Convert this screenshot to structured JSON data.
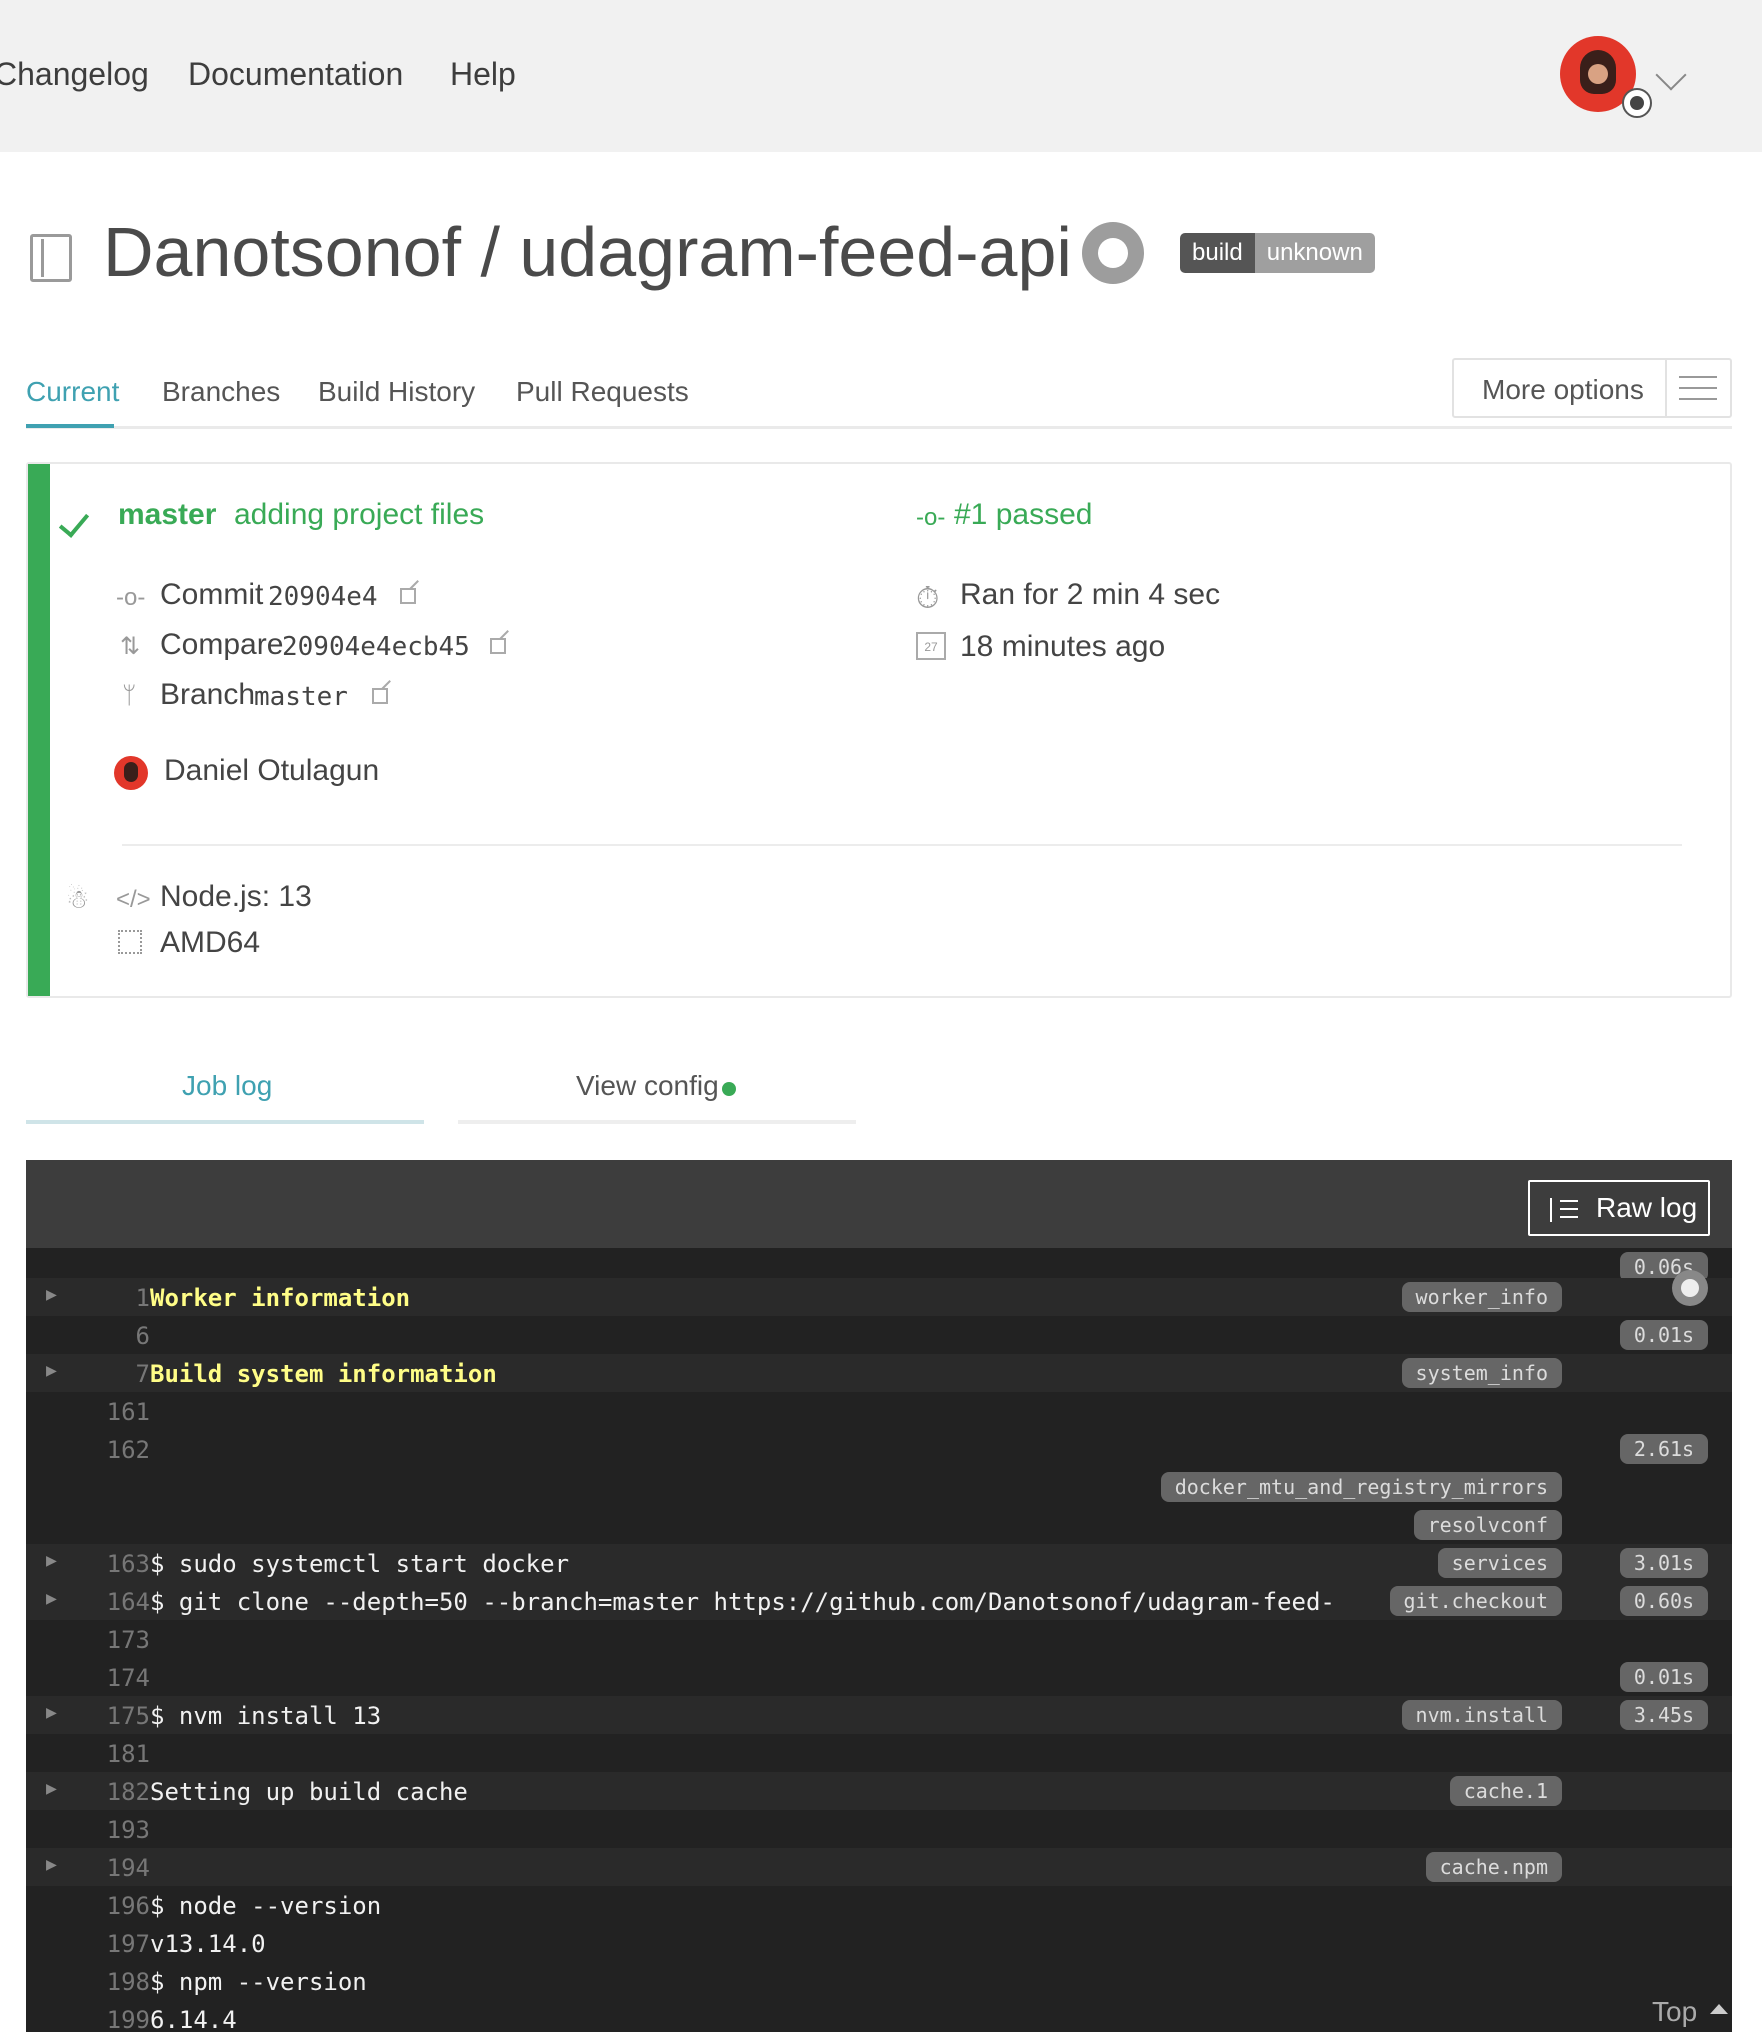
{
  "nav": {
    "links": [
      "Changelog",
      "Documentation",
      "Help"
    ]
  },
  "repo": {
    "title": "Danotsonof / udagram-feed-api",
    "badge_left": "build",
    "badge_right": "unknown"
  },
  "tabs": {
    "items": [
      "Current",
      "Branches",
      "Build History",
      "Pull Requests"
    ],
    "active": "Current",
    "more_options": "More options"
  },
  "build": {
    "branch": "master",
    "message": "adding project files",
    "status": "#1 passed",
    "commit_label": "Commit",
    "commit_value": "20904e4",
    "compare_label": "Compare",
    "compare_value": "20904e4ecb45",
    "branch_label": "Branch",
    "branch_value": "master",
    "ran_for": "Ran for 2 min 4 sec",
    "ago": "18 minutes ago",
    "calendar_day": "27",
    "author": "Daniel Otulagun",
    "language": "Node.js: 13",
    "arch": "AMD64",
    "status_color": "#39aa56"
  },
  "lower_tabs": {
    "job_log": "Job log",
    "view_config": "View config"
  },
  "log": {
    "raw_log": "Raw log",
    "top": "Top",
    "lines": [
      {
        "num": "1",
        "text": "Worker information",
        "tag": "worker_info",
        "time": "",
        "fold": true,
        "yellow": true
      },
      {
        "num": "6",
        "text": "",
        "tag": "",
        "time": "0.01s",
        "fold": false,
        "yellow": false
      },
      {
        "num": "7",
        "text": "Build system information",
        "tag": "system_info",
        "time": "",
        "fold": true,
        "yellow": true
      },
      {
        "num": "161",
        "text": "",
        "tag": "",
        "time": "",
        "fold": false,
        "yellow": false
      },
      {
        "num": "162",
        "text": "",
        "tag": "",
        "time": "2.61s",
        "fold": false,
        "yellow": false
      },
      {
        "num": "",
        "text": "",
        "tag": "docker_mtu_and_registry_mirrors",
        "time": "",
        "fold": false,
        "yellow": false
      },
      {
        "num": "",
        "text": "",
        "tag": "resolvconf",
        "time": "",
        "fold": false,
        "yellow": false
      },
      {
        "num": "163",
        "text": "$ sudo systemctl start docker",
        "tag": "services",
        "time": "3.01s",
        "fold": true,
        "yellow": false
      },
      {
        "num": "164",
        "text": "$ git clone --depth=50 --branch=master https://github.com/Danotsonof/udagram-feed-",
        "tag": "git.checkout",
        "time": "0.60s",
        "fold": true,
        "yellow": false
      },
      {
        "num": "173",
        "text": "",
        "tag": "",
        "time": "",
        "fold": false,
        "yellow": false
      },
      {
        "num": "174",
        "text": "",
        "tag": "",
        "time": "0.01s",
        "fold": false,
        "yellow": false
      },
      {
        "num": "175",
        "text": "$ nvm install 13",
        "tag": "nvm.install",
        "time": "3.45s",
        "fold": true,
        "yellow": false
      },
      {
        "num": "181",
        "text": "",
        "tag": "",
        "time": "",
        "fold": false,
        "yellow": false
      },
      {
        "num": "182",
        "text": "Setting up build cache",
        "tag": "cache.1",
        "time": "",
        "fold": true,
        "yellow": false
      },
      {
        "num": "193",
        "text": "",
        "tag": "",
        "time": "",
        "fold": false,
        "yellow": false
      },
      {
        "num": "194",
        "text": "",
        "tag": "cache.npm",
        "time": "",
        "fold": true,
        "yellow": false
      },
      {
        "num": "196",
        "text": "$ node --version",
        "tag": "",
        "time": "",
        "fold": false,
        "yellow": false
      },
      {
        "num": "197",
        "text": "v13.14.0",
        "tag": "",
        "time": "",
        "fold": false,
        "yellow": false
      },
      {
        "num": "198",
        "text": "$ npm --version",
        "tag": "",
        "time": "",
        "fold": false,
        "yellow": false
      },
      {
        "num": "199",
        "text": "6.14.4",
        "tag": "",
        "time": "",
        "fold": false,
        "yellow": false
      }
    ],
    "first_time": "0.06s"
  }
}
